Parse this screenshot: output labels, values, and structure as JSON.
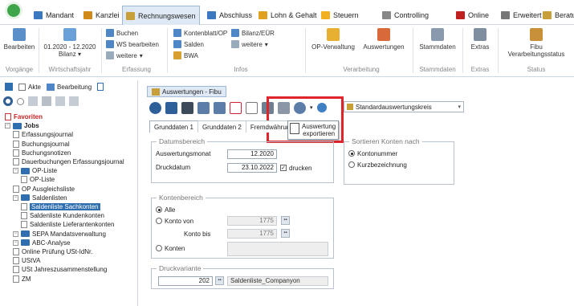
{
  "tabs": [
    {
      "label": "Mandant",
      "color": "#3a78c2"
    },
    {
      "label": "Kanzlei",
      "color": "#d08a1a"
    },
    {
      "label": "Rechnungswesen",
      "color": "#c8a03a"
    },
    {
      "label": "Abschluss",
      "color": "#3a78c2"
    },
    {
      "label": "Lohn & Gehalt",
      "color": "#e0a020"
    },
    {
      "label": "Steuern",
      "color": "#f0b020"
    },
    {
      "label": "Controlling",
      "color": "#888888"
    },
    {
      "label": "Online",
      "color": "#c02020"
    },
    {
      "label": "Erweitert",
      "color": "#777777"
    },
    {
      "label": "Beratung",
      "color": "#c8a03a"
    }
  ],
  "ribbon": {
    "bearbeiten": "Bearbeiten",
    "vorgaenge": "Vorgänge",
    "wj_line1": "01.2020 - 12.2020",
    "wj_line2": "Bilanz",
    "wirtschaftsjahr": "Wirtschaftsjahr",
    "buchen": "Buchen",
    "ws_bearbeiten": "WS bearbeiten",
    "weitere": "weitere",
    "erfassung": "Erfassung",
    "kontenblatt": "Kontenblatt/OP",
    "salden": "Salden",
    "bwa": "BWA",
    "bilanz_eur": "Bilanz/EÜR",
    "weitere2": "weitere",
    "infos": "Infos",
    "op_verwaltung": "OP-Verwaltung",
    "auswertungen": "Auswertungen",
    "verarbeitung": "Verarbeitung",
    "stammdaten": "Stammdaten",
    "stammdaten_grp": "Stammdaten",
    "extras": "Extras",
    "extras_grp": "Extras",
    "fibu_line1": "Fibu",
    "fibu_line2": "Verarbeitungsstatus",
    "status": "Status"
  },
  "leftpane": {
    "akte": "Akte",
    "bearbeitung": "Bearbeitung",
    "tree": [
      {
        "label": "Favoriten",
        "type": "fav",
        "level": 0
      },
      {
        "label": "Jobs",
        "type": "bold",
        "level": 0
      },
      {
        "label": "Erfassungsjournal",
        "type": "doc",
        "level": 1
      },
      {
        "label": "Buchungsjournal",
        "type": "doc",
        "level": 1
      },
      {
        "label": "Buchungsnotizen",
        "type": "doc",
        "level": 1
      },
      {
        "label": "Dauerbuchungen Erfassungsjournal",
        "type": "doc",
        "level": 1
      },
      {
        "label": "OP-Liste",
        "type": "folder",
        "level": 1
      },
      {
        "label": "OP-Liste",
        "type": "doc",
        "level": 2
      },
      {
        "label": "OP Ausgleichsliste",
        "type": "doc",
        "level": 1
      },
      {
        "label": "Saldenlisten",
        "type": "folder",
        "level": 1
      },
      {
        "label": "Saldenliste Sachkonten",
        "type": "selected",
        "level": 2
      },
      {
        "label": "Saldenliste Kundenkonten",
        "type": "doc",
        "level": 2
      },
      {
        "label": "Saldenliste Lieferantenkonten",
        "type": "doc",
        "level": 2
      },
      {
        "label": "SEPA Mandatsverwaltung",
        "type": "folder",
        "level": 1
      },
      {
        "label": "ABC-Analyse",
        "type": "folder",
        "level": 1
      },
      {
        "label": "Online Prüfung USt-IdNr.",
        "type": "doc",
        "level": 1
      },
      {
        "label": "UStVA",
        "type": "doc",
        "level": 1
      },
      {
        "label": "USt Jahreszusammenstellung",
        "type": "doc",
        "level": 1
      },
      {
        "label": "ZM",
        "type": "doc",
        "level": 1
      }
    ]
  },
  "main": {
    "doc_tab": "Auswertungen - Fibu",
    "combo": "Standardauswertungskreis",
    "subtabs": [
      "Grunddaten 1",
      "Grunddaten 2",
      "Fremdwährung"
    ],
    "tooltip_line1": "Auswertung",
    "tooltip_line2": "exportieren",
    "datumsbereich": {
      "title": "Datumsbereich",
      "auswertungsmonat_label": "Auswertungsmonat",
      "auswertungsmonat": "12.2020",
      "druckdatum_label": "Druckdatum",
      "druckdatum": "23.10.2022",
      "drucken": "drucken"
    },
    "sortieren": {
      "title": "Sortieren Konten nach",
      "kontonummer": "Kontonummer",
      "kurzbezeichnung": "Kurzbezeichnung"
    },
    "kontenbereich": {
      "title": "Kontenbereich",
      "alle": "Alle",
      "konto_von": "Konto von",
      "konto_von_val": "1775",
      "konto_bis": "Konto bis",
      "konto_bis_val": "1775",
      "konten": "Konten"
    },
    "druckvariante": {
      "title": "Druckvariante",
      "nr": "202",
      "name": "Saldenliste_Companyon"
    }
  }
}
